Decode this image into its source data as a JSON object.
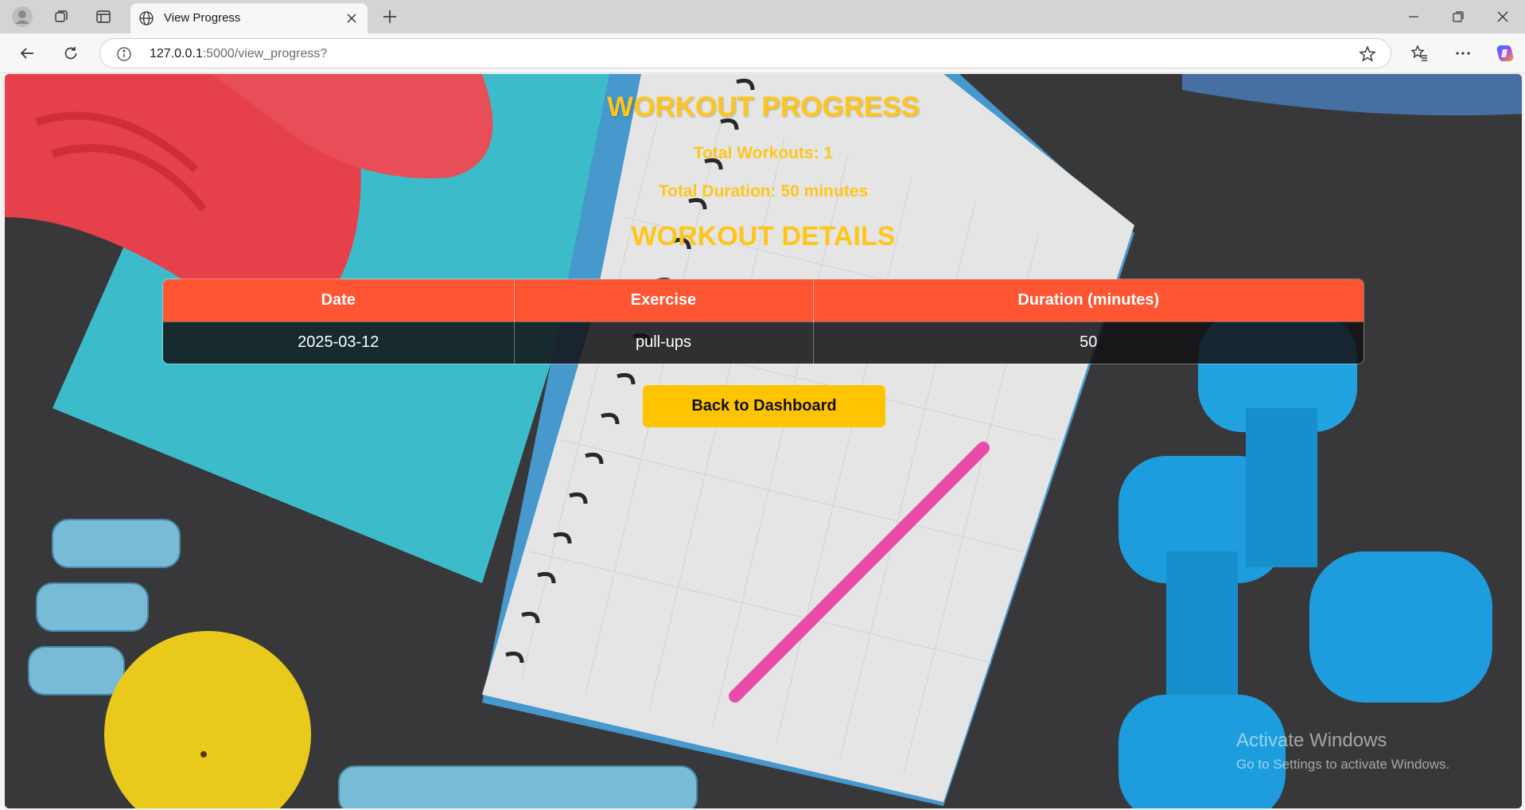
{
  "browser": {
    "tab_title": "View Progress",
    "url_host": "127.0.0.1",
    "url_path": ":5000/view_progress?"
  },
  "page": {
    "title": "WORKOUT PROGRESS",
    "total_workouts": "Total Workouts: 1",
    "total_duration": "Total Duration: 50 minutes",
    "details_title": "WORKOUT DETAILS",
    "back_button": "Back to Dashboard"
  },
  "table": {
    "headers": [
      "Date",
      "Exercise",
      "Duration (minutes)"
    ],
    "rows": [
      [
        "2025-03-12",
        "pull-ups",
        "50"
      ]
    ]
  },
  "watermark": {
    "title": "Activate Windows",
    "subtitle": "Go to Settings to activate Windows."
  },
  "colors": {
    "accent_yellow": "#ffc61a",
    "table_header": "#ff5533",
    "button": "#ffc400"
  }
}
